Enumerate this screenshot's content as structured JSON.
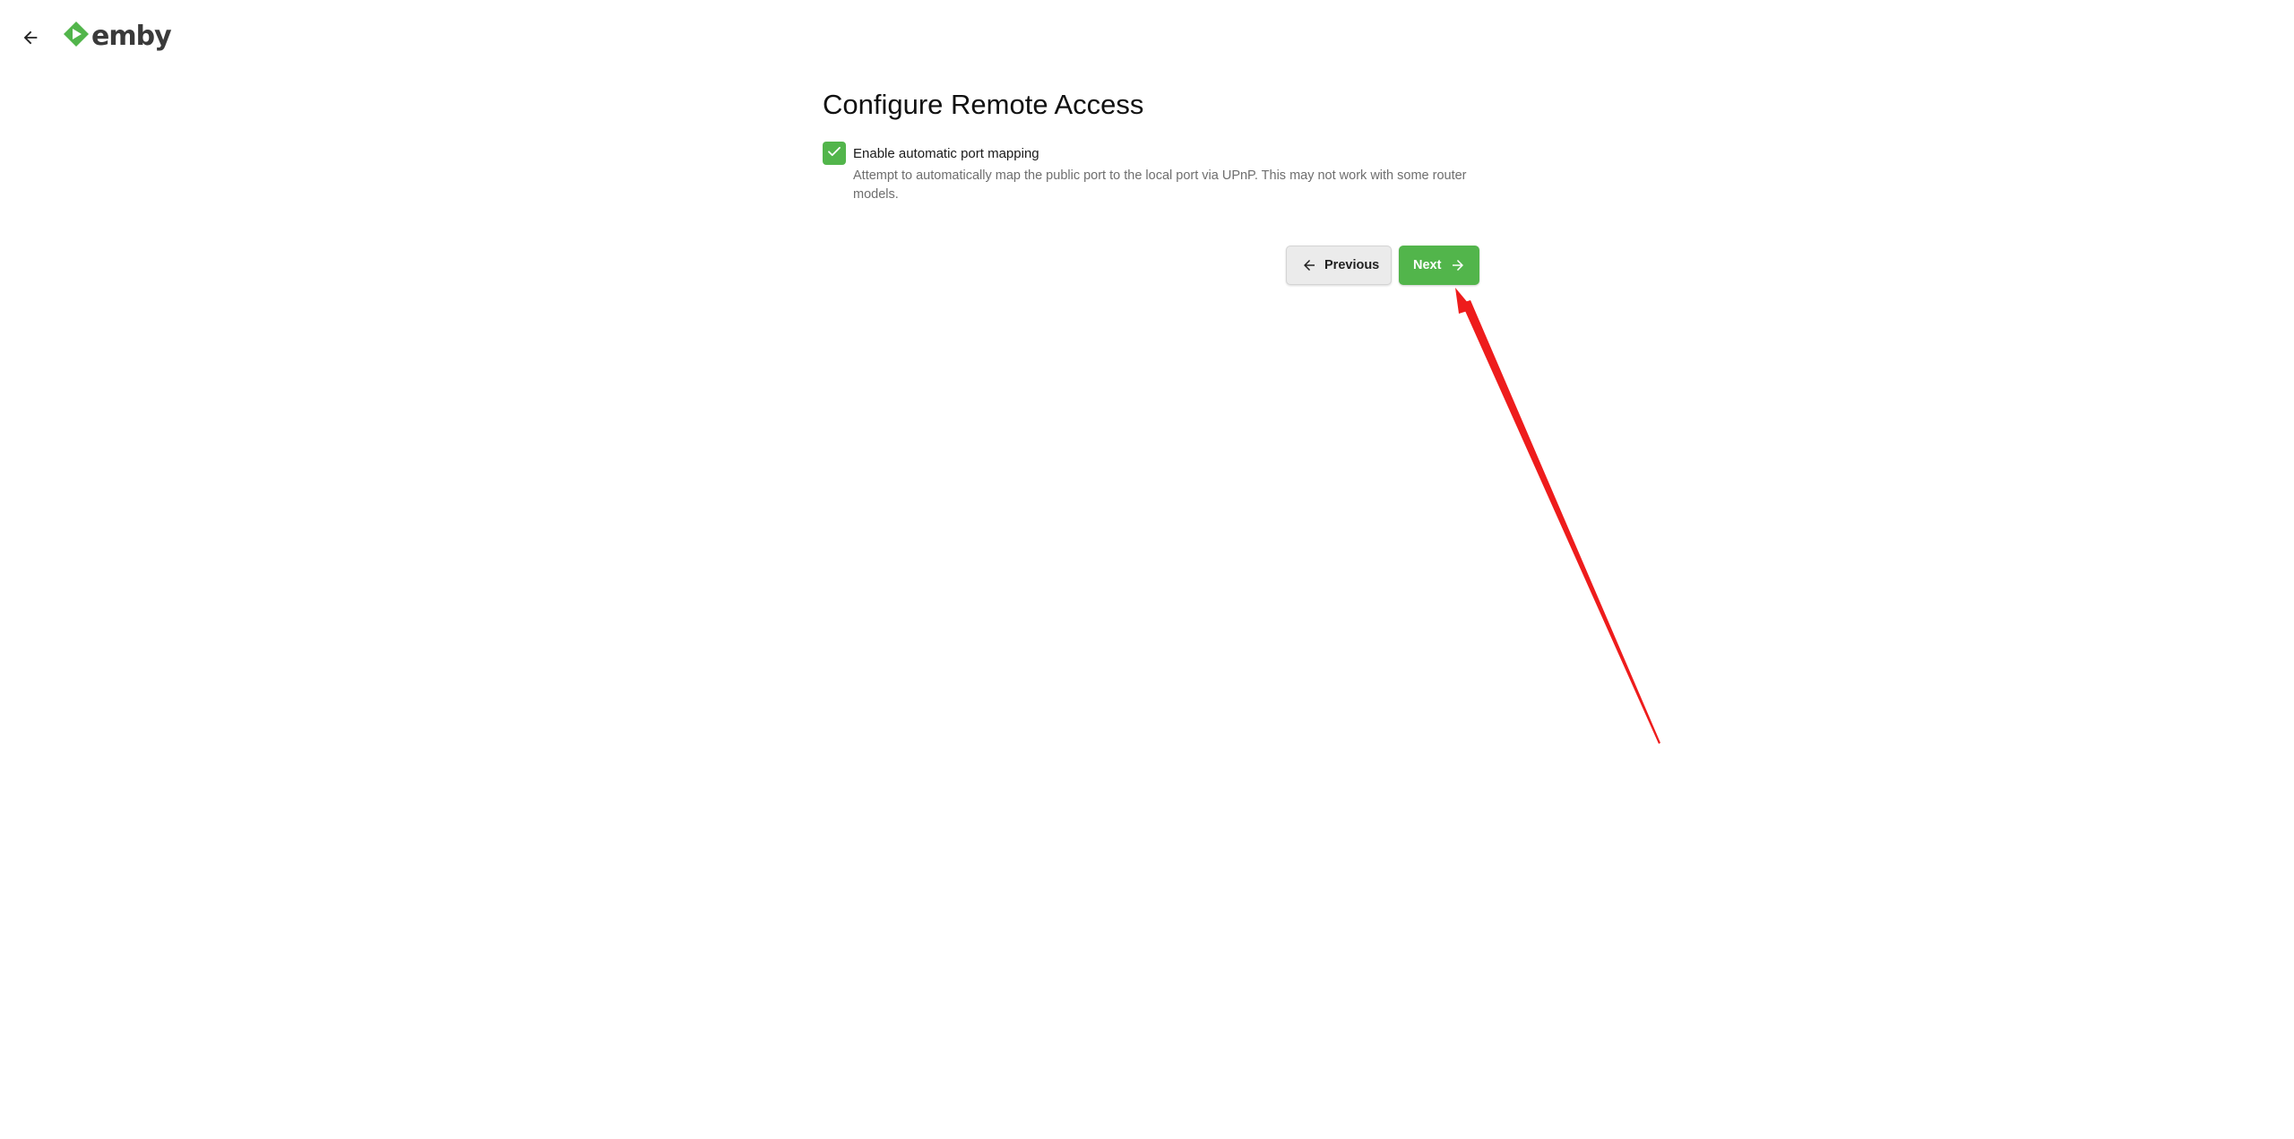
{
  "app": {
    "brand": "emby",
    "accent_color": "#52b54b"
  },
  "header": {
    "back_icon": "arrow-left-icon",
    "logo_icon": "emby-play-logo-icon"
  },
  "main": {
    "title": "Configure Remote Access",
    "upnp": {
      "checked": true,
      "label": "Enable automatic port mapping",
      "description": "Attempt to automatically map the public port to the local port via UPnP. This may not work with some router models."
    },
    "buttons": {
      "previous_label": "Previous",
      "next_label": "Next",
      "previous_icon": "arrow-left-icon",
      "next_icon": "arrow-right-icon"
    }
  },
  "annotation": {
    "color": "#ee1c1c",
    "target": "next-button"
  }
}
